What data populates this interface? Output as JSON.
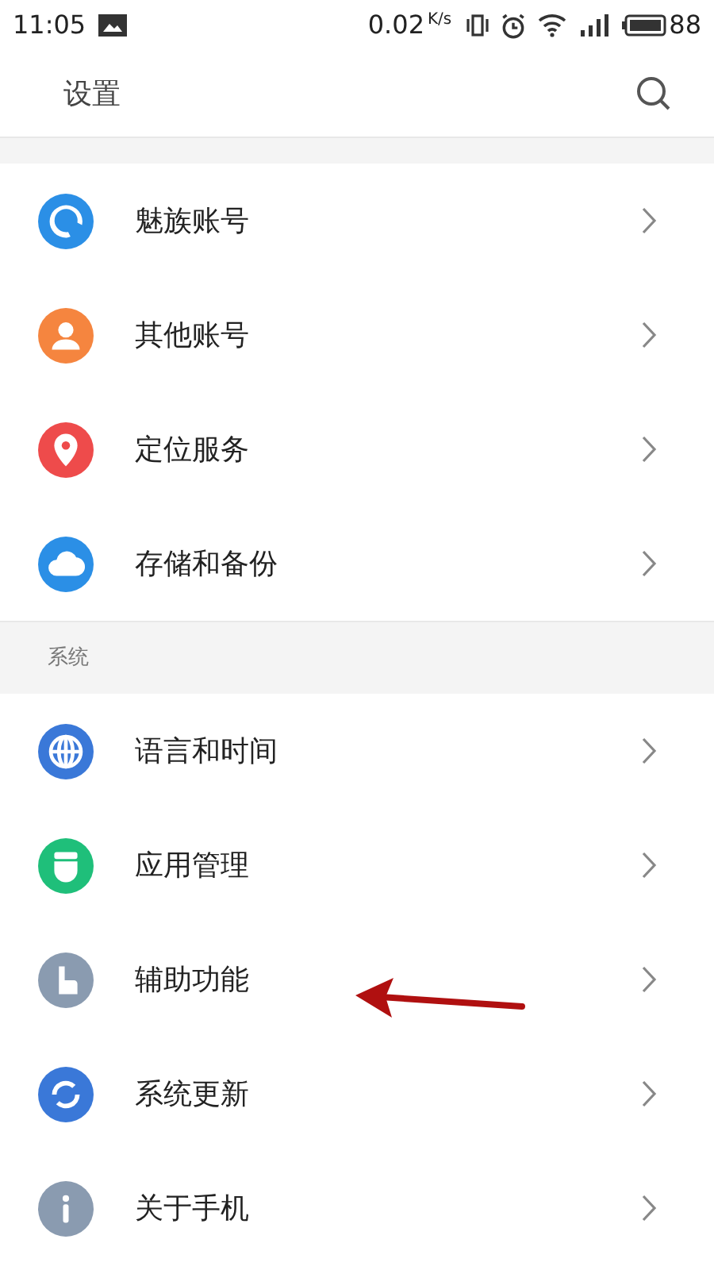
{
  "status_bar": {
    "time": "11:05",
    "speed": "0.02",
    "speed_unit": "K/s",
    "battery": "88"
  },
  "header": {
    "title": "设置"
  },
  "sections": [
    {
      "items": [
        {
          "label": "魅族账号",
          "color": "#2b8fe6"
        },
        {
          "label": "其他账号",
          "color": "#f5853f"
        },
        {
          "label": "定位服务",
          "color": "#ee4b4b"
        },
        {
          "label": "存储和备份",
          "color": "#2b8fe6"
        }
      ]
    },
    {
      "title": "系统",
      "items": [
        {
          "label": "语言和时间",
          "color": "#3a78d8"
        },
        {
          "label": "应用管理",
          "color": "#1fbf7a"
        },
        {
          "label": "辅助功能",
          "color": "#8a9bb0"
        },
        {
          "label": "系统更新",
          "color": "#3a78d8"
        },
        {
          "label": "关于手机",
          "color": "#8a9bb0"
        }
      ]
    }
  ]
}
